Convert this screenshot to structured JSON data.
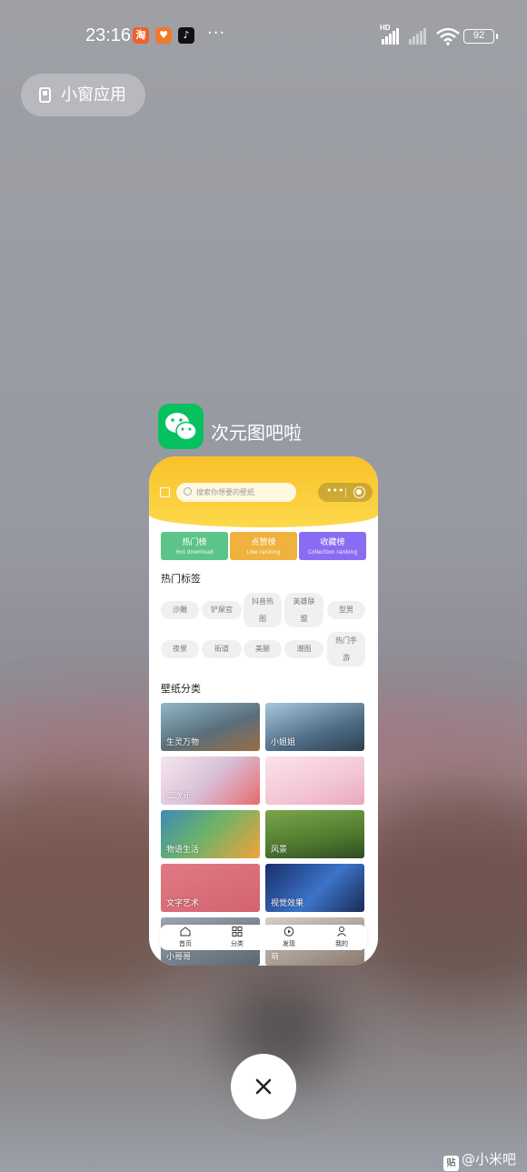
{
  "status_bar": {
    "time": "23:16",
    "app_icons": [
      "taobao-icon",
      "tmall-cat-icon",
      "tiktok-icon"
    ],
    "more": "···",
    "hd": "HD",
    "battery": "92"
  },
  "chip": {
    "label": "小窗应用"
  },
  "app": {
    "name": "次元图吧啦"
  },
  "miniapp": {
    "search_placeholder": "搜索你想要的壁纸",
    "capsule_more": "•••",
    "ranks": [
      {
        "title": "热门榜",
        "sub": "Hot download",
        "color": "#5cc489"
      },
      {
        "title": "点赞榜",
        "sub": "Like ranking",
        "color": "#f0b23e"
      },
      {
        "title": "收藏榜",
        "sub": "Collection ranking",
        "color": "#8a6cf4"
      }
    ],
    "hot_tags_title": "热门标签",
    "tags": [
      "沙雕",
      "铲屎官",
      "抖音热图",
      "英雄联盟",
      "型男",
      "夜景",
      "街道",
      "美腿",
      "潮图",
      "热门手游"
    ],
    "category_title": "壁纸分类",
    "categories": [
      "生灵万物",
      "小姐姐",
      "二次元",
      "",
      "物语生活",
      "风景",
      "文字艺术",
      "视觉效果",
      "小哥哥",
      "萌"
    ],
    "tabs": [
      "首页",
      "分类",
      "发现",
      "我的"
    ]
  },
  "watermark": {
    "text": "@小米吧",
    "icon": "贴"
  }
}
